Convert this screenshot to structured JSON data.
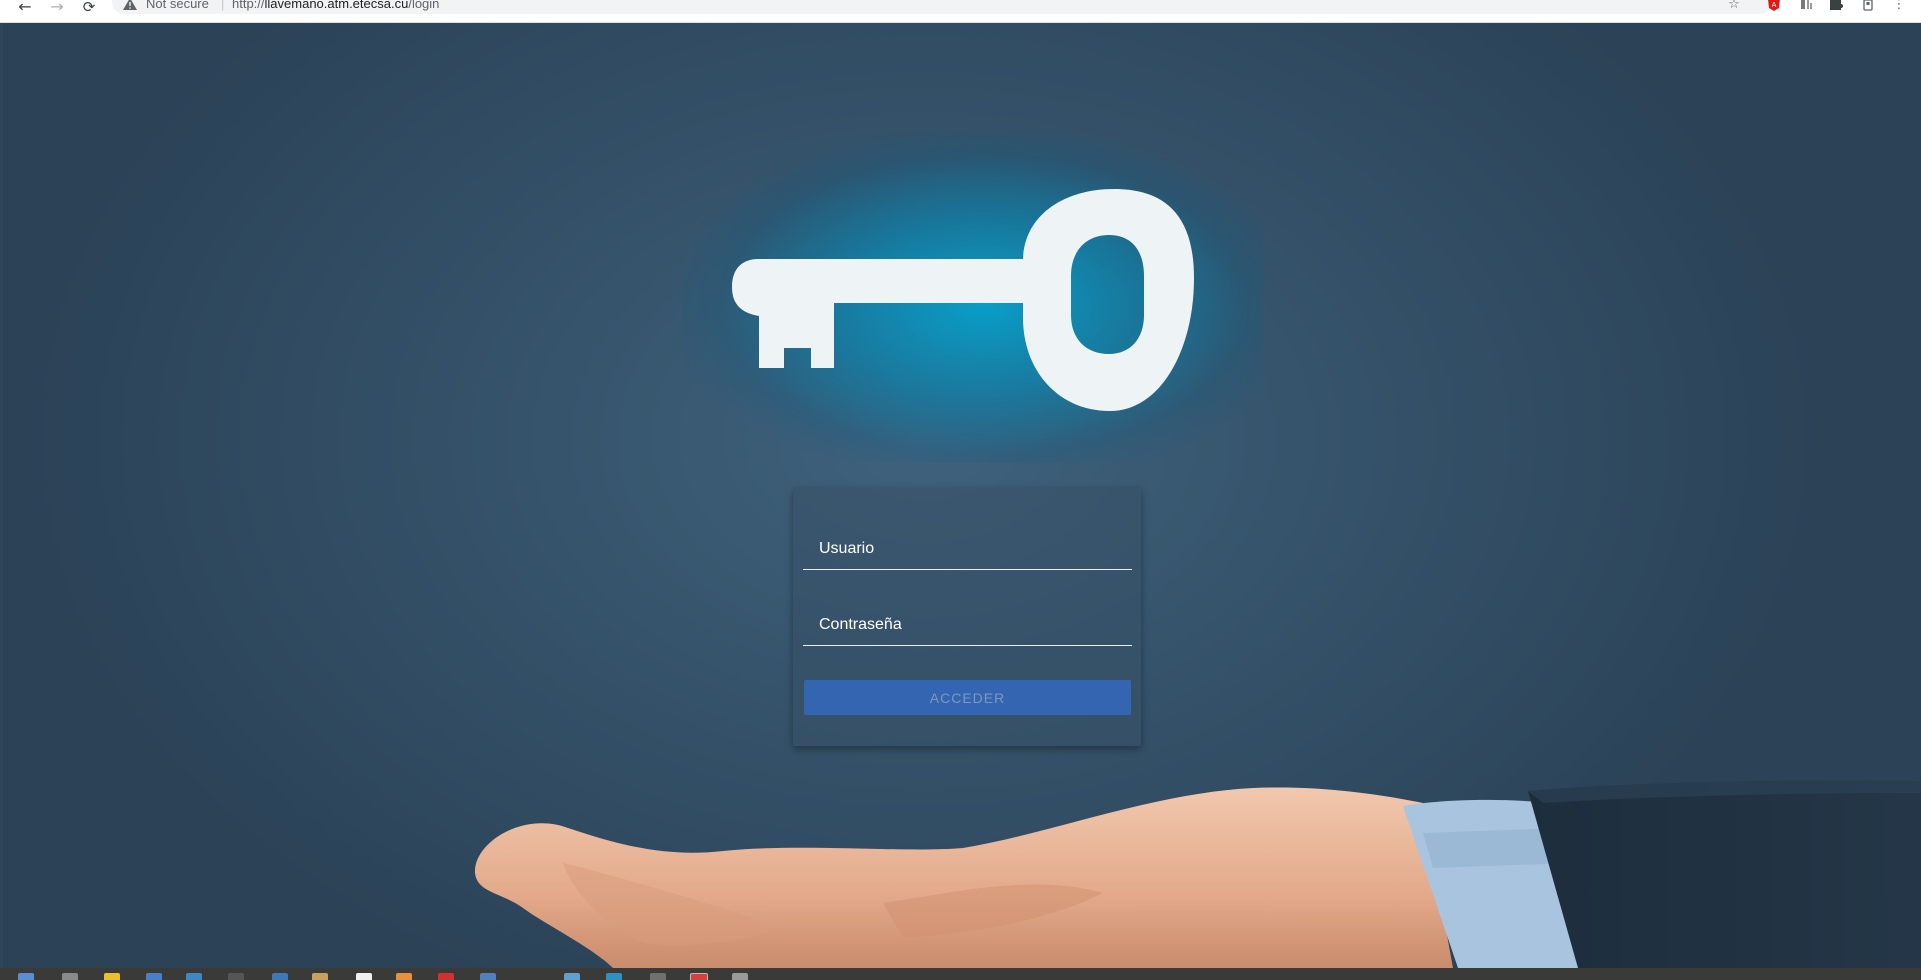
{
  "browser": {
    "back_icon": "arrow-left-icon",
    "forward_icon": "arrow-right-icon",
    "reload_icon": "reload-icon",
    "security_label": "Not secure",
    "url_scheme": "http://",
    "url_host": "llavemano.atm.etecsa.cu",
    "url_path": "/login",
    "url_separator": "|",
    "right_icons": [
      "star-icon",
      "angular-extension-icon",
      "extension-icon",
      "puzzle-icon",
      "profile-icon",
      "menu-icon"
    ]
  },
  "login": {
    "username_placeholder": "Usuario",
    "password_placeholder": "Contraseña",
    "submit_label": "ACCEDER"
  },
  "colors": {
    "page_background": "#2e465c",
    "key_glow": "#00a0cc",
    "key": "#eef4f6",
    "button": "#3465b0",
    "button_text": "#7d97bf"
  },
  "taskbar": {
    "icons": [
      "files-icon",
      "terminal-icon",
      "warning-app-icon",
      "document-icon",
      "browser-icon",
      "terminal-icon",
      "settings-icon",
      "package-icon",
      "text-editor-icon",
      "media-icon",
      "pdf-icon",
      "network-icon",
      "image-icon",
      "chrome-icon",
      "app-icon",
      "chrome-icon",
      "app-icon"
    ]
  }
}
